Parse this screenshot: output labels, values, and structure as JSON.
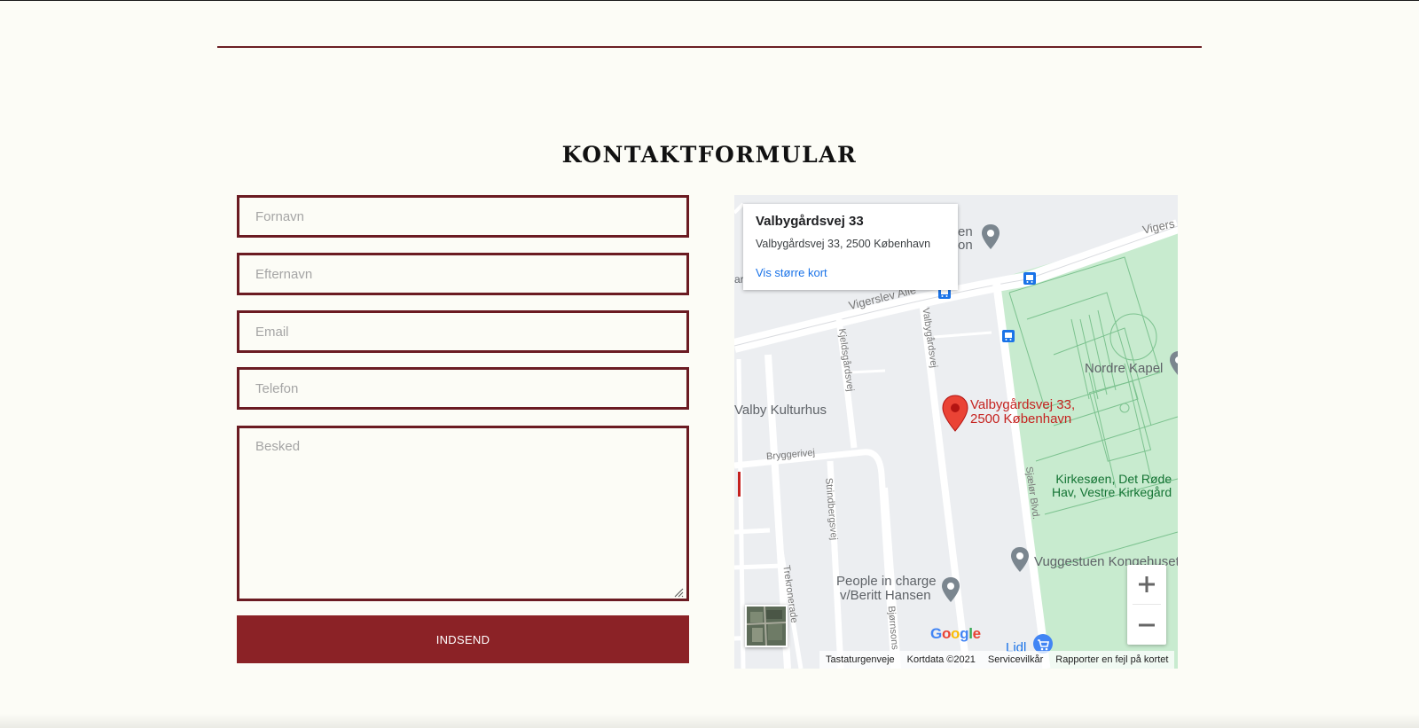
{
  "page": {
    "title": "KONTAKTFORMULAR",
    "colors": {
      "background": "#fcfcf6",
      "accent": "#8b2226",
      "field_border": "#6b1b22"
    }
  },
  "form": {
    "first_name": {
      "placeholder": "Fornavn",
      "value": ""
    },
    "last_name": {
      "placeholder": "Efternavn",
      "value": ""
    },
    "email": {
      "placeholder": "Email",
      "value": ""
    },
    "phone": {
      "placeholder": "Telefon",
      "value": ""
    },
    "message": {
      "placeholder": "Besked",
      "value": ""
    },
    "submit_label": "INDSEND"
  },
  "map": {
    "info_title": "Valbygårdsvej 33",
    "info_address": "Valbygårdsvej 33, 2500 København",
    "info_link": "Vis større kort",
    "marker_label_line1": "Valbygårdsvej 33,",
    "marker_label_line2": "2500 København",
    "places": {
      "nordre_kapel": "Nordre Kapel",
      "valby_kulturhus": "Valby Kulturhus",
      "kirkesoen_line1": "Kirkesøen, Det Røde",
      "kirkesoen_line2": "Hav, Vestre Kirkegård",
      "vuggestuen": "Vuggestuen Kongehuset",
      "people_line1": "People in charge",
      "people_line2": "v/Beritt Hansen",
      "lidl": "Lidl",
      "partial_top": "en",
      "partial_top2": "on",
      "partial_left": "ara"
    },
    "streets": {
      "vigerslev_alle": "Vigerslev Alle",
      "vigerslev_partial": "Vigers",
      "kjeldsgaardsvej": "Kjeldsgårdsvej",
      "valbygaardsvej": "Valbygårdsvej",
      "bryggerivej": "Bryggerivej",
      "strindbergsvej": "Strindbergsvej",
      "trekronerade": "Trekronerade",
      "bjornsons": "Bjørnsons",
      "sjaelor_blvd": "Sjælør Blvd."
    },
    "google": "Google",
    "attribution": [
      "Tastaturgenveje",
      "Kortdata ©2021",
      "Servicevilkår",
      "Rapporter en fejl på kortet"
    ]
  }
}
